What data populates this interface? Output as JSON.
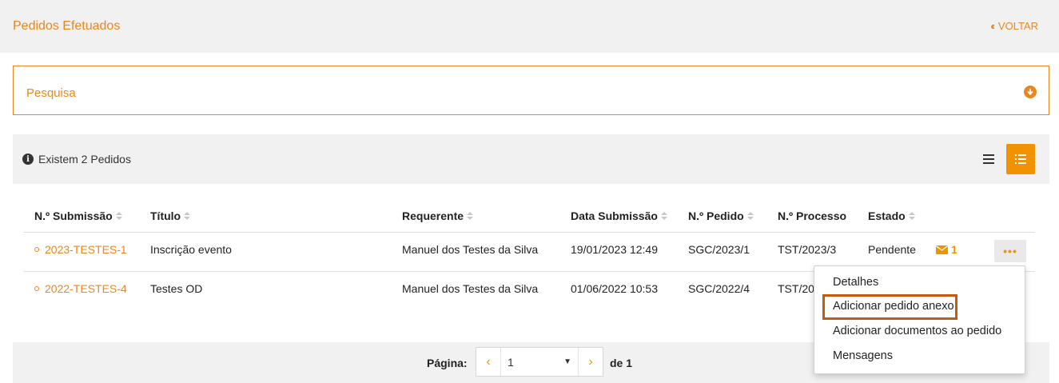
{
  "header": {
    "title": "Pedidos Efetuados",
    "back_label": "VOLTAR"
  },
  "search": {
    "label": "Pesquisa"
  },
  "list": {
    "count_text": "Existem 2 Pedidos",
    "columns": [
      "N.º Submissão",
      "Título",
      "Requerente",
      "Data Submissão",
      "N.º Pedido",
      "N.º Processo",
      "Estado"
    ],
    "rows": [
      {
        "submission": "2023-TESTES-1",
        "title": "Inscrição evento",
        "requester": "Manuel dos Testes da Silva",
        "date": "19/01/2023 12:49",
        "request_no": "SGC/2023/1",
        "process_no": "TST/2023/3",
        "state": "Pendente",
        "messages": "1"
      },
      {
        "submission": "2022-TESTES-4",
        "title": "Testes OD",
        "requester": "Manuel dos Testes da Silva",
        "date": "01/06/2022 10:53",
        "request_no": "SGC/2022/4",
        "process_no": "TST/20",
        "state": "",
        "messages": ""
      }
    ]
  },
  "pager": {
    "label": "Página:",
    "current": "1",
    "of_text": "de 1"
  },
  "actions_menu": {
    "items": [
      "Detalhes",
      "Adicionar pedido anexo",
      "Adicionar documentos ao pedido",
      "Mensagens"
    ]
  },
  "colors": {
    "accent": "#e8871e",
    "accent_button": "#f39200",
    "highlight_border": "#c55a11",
    "panel_bg": "#f1f1f1"
  },
  "icons": {
    "back": "double-chevron-left-icon",
    "search_toggle": "arrow-down-circle-icon",
    "info": "info-circle-icon",
    "compact_view": "list-lines-icon",
    "detail_view": "list-bullets-icon",
    "messages": "envelope-icon",
    "actions": "ellipsis-icon"
  }
}
